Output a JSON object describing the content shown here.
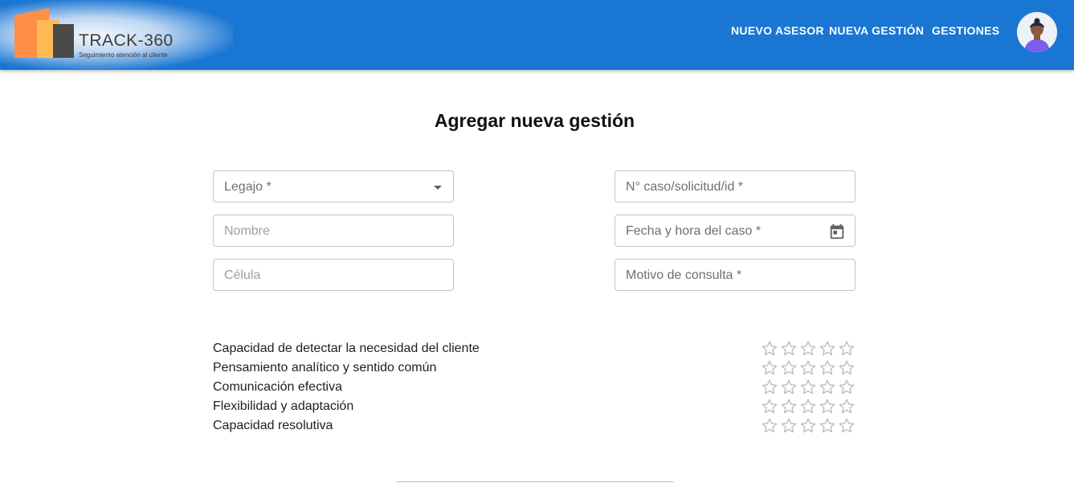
{
  "header": {
    "logo_title": "TRACK-360",
    "logo_subtitle": "Seguimiento atención al cliente",
    "nav": {
      "new_advisor": "NUEVO ASESOR",
      "new_case": "NUEVA GESTIÓN",
      "cases": "GESTIONES"
    },
    "avatar_icon": "user-avatar",
    "brand_color": "#1976d2"
  },
  "page": {
    "title": "Agregar nueva gestión"
  },
  "form": {
    "legajo": {
      "label": "Legajo *",
      "value": ""
    },
    "nombre": {
      "label": "Nombre",
      "value": ""
    },
    "celula": {
      "label": "Célula",
      "value": ""
    },
    "caso_id": {
      "label": "N° caso/solicitud/id *",
      "value": ""
    },
    "fecha_hora": {
      "label": "Fecha y hora del caso *",
      "value": "",
      "icon": "calendar-icon"
    },
    "motivo": {
      "label": "Motivo de consulta *",
      "value": ""
    }
  },
  "ratings": {
    "max": 5,
    "items": [
      {
        "label": "Capacidad de detectar la necesidad del cliente",
        "value": 0
      },
      {
        "label": "Pensamiento analítico y sentido común",
        "value": 0
      },
      {
        "label": "Comunicación efectiva",
        "value": 0
      },
      {
        "label": "Flexibilidad y adaptación",
        "value": 0
      },
      {
        "label": "Capacidad resolutiva",
        "value": 0
      }
    ]
  }
}
